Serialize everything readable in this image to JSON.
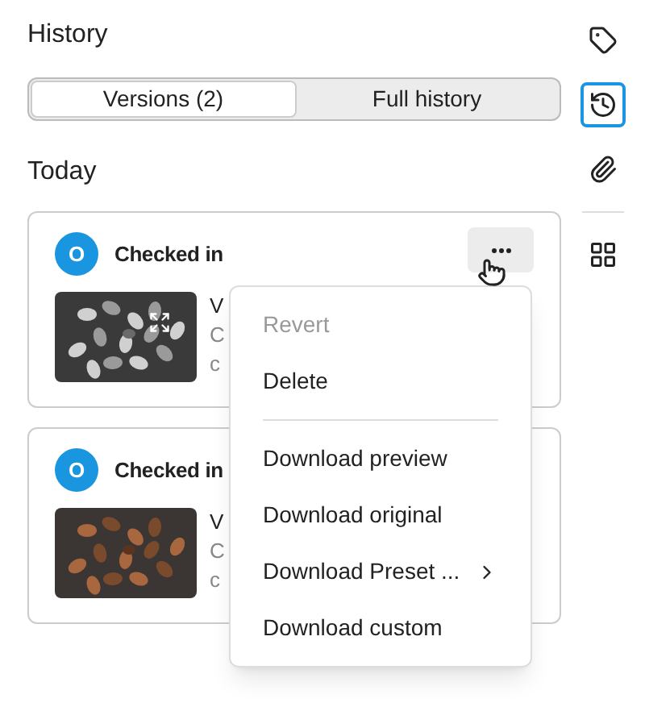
{
  "panel": {
    "title": "History"
  },
  "tabs": [
    {
      "label": "Versions (2)",
      "selected": true
    },
    {
      "label": "Full history",
      "selected": false
    }
  ],
  "section": "Today",
  "entries": [
    {
      "avatar": "O",
      "action": "Checked in",
      "lines": [
        "V",
        "C",
        "c"
      ],
      "grayscale": true,
      "menu_open": true
    },
    {
      "avatar": "O",
      "action": "Checked in",
      "lines": [
        "V",
        "C",
        "c"
      ],
      "grayscale": false,
      "menu_open": false
    }
  ],
  "menu": [
    {
      "kind": "item",
      "label": "Revert",
      "disabled": true,
      "submenu": false
    },
    {
      "kind": "item",
      "label": "Delete",
      "disabled": false,
      "submenu": false
    },
    {
      "kind": "divider"
    },
    {
      "kind": "item",
      "label": "Download preview",
      "disabled": false,
      "submenu": false
    },
    {
      "kind": "item",
      "label": "Download original",
      "disabled": false,
      "submenu": false
    },
    {
      "kind": "item",
      "label": "Download Preset ...",
      "disabled": false,
      "submenu": true
    },
    {
      "kind": "item",
      "label": "Download custom",
      "disabled": false,
      "submenu": false
    }
  ],
  "rail": [
    {
      "kind": "tag",
      "selected": false
    },
    {
      "kind": "history",
      "selected": true
    },
    {
      "kind": "attachment",
      "selected": false
    },
    {
      "kind": "divider"
    },
    {
      "kind": "apps",
      "selected": false
    }
  ]
}
